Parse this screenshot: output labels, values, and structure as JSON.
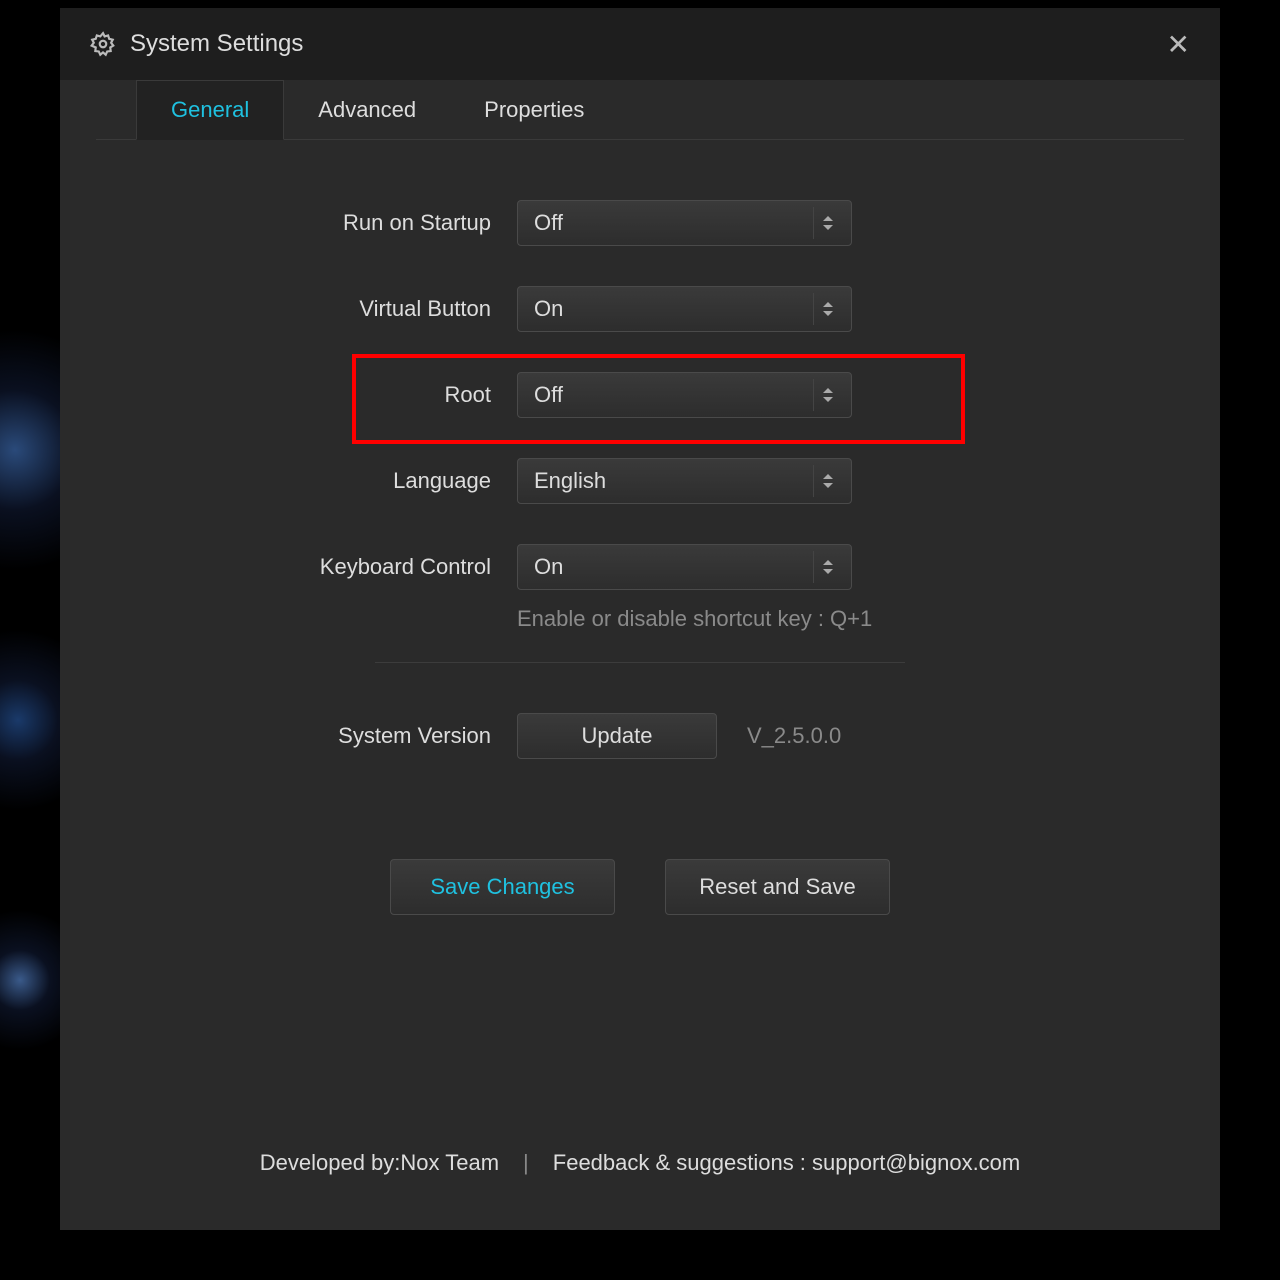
{
  "window": {
    "title": "System Settings"
  },
  "tabs": {
    "general": "General",
    "advanced": "Advanced",
    "properties": "Properties"
  },
  "fields": {
    "startup": {
      "label": "Run on Startup",
      "value": "Off"
    },
    "vbutton": {
      "label": "Virtual Button",
      "value": "On"
    },
    "root": {
      "label": "Root",
      "value": "Off"
    },
    "language": {
      "label": "Language",
      "value": "English"
    },
    "keyboard": {
      "label": "Keyboard Control",
      "value": "On",
      "hint": "Enable or disable shortcut key : Q+1"
    }
  },
  "system": {
    "label": "System Version",
    "update": "Update",
    "version": "V_2.5.0.0"
  },
  "actions": {
    "save": "Save Changes",
    "reset": "Reset and Save"
  },
  "footer": {
    "dev": "Developed by:Nox Team",
    "feedback": "Feedback & suggestions : support@bignox.com"
  }
}
